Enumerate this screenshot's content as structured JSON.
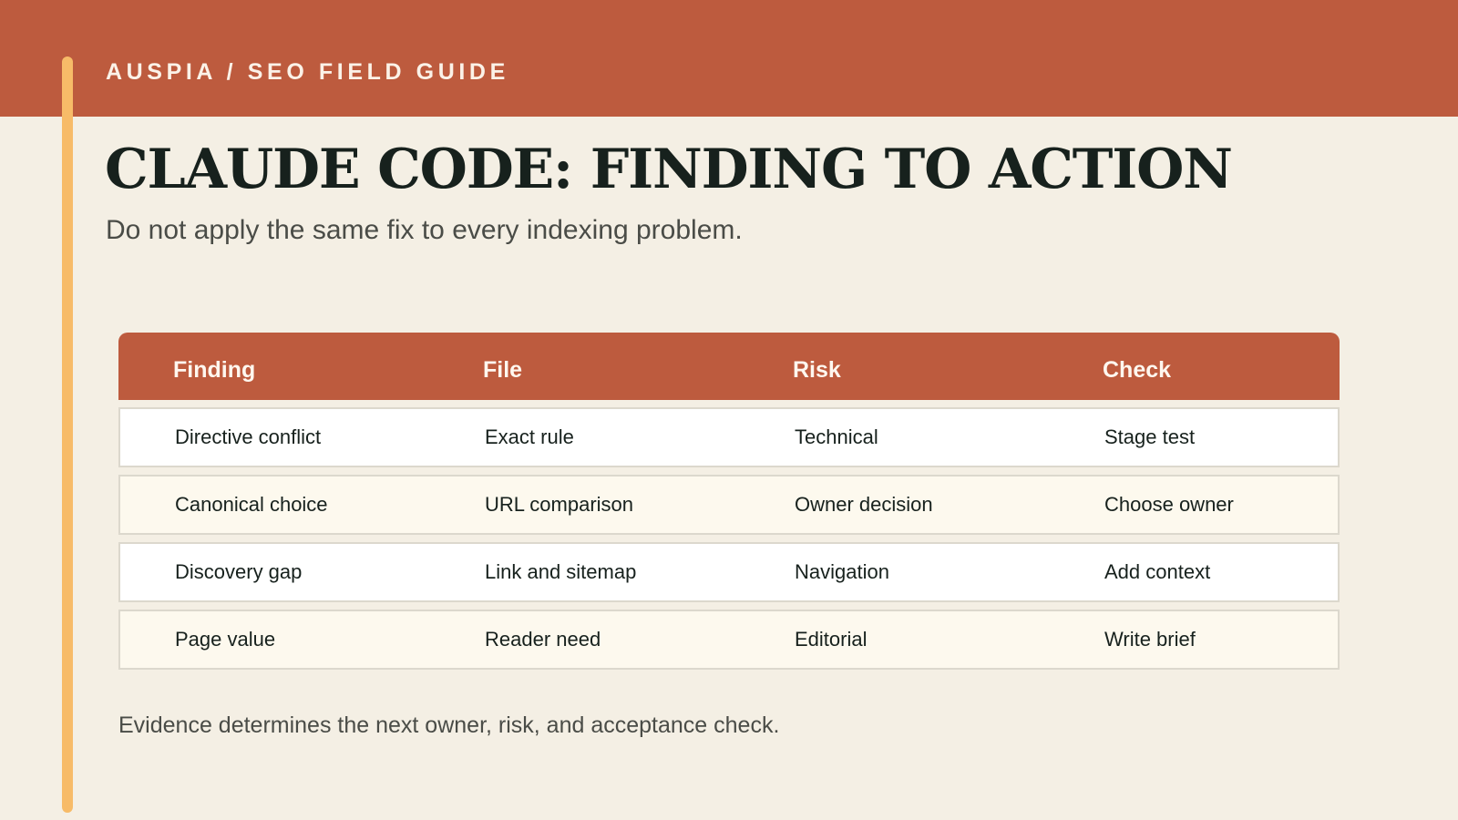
{
  "header": {
    "kicker": "AUSPIA / SEO FIELD GUIDE",
    "title": "CLAUDE CODE: FINDING TO ACTION",
    "subtitle": "Do not apply the same fix to every indexing problem."
  },
  "table": {
    "columns": [
      "Finding",
      "File",
      "Risk",
      "Check"
    ],
    "rows": [
      [
        "Directive conflict",
        "Exact rule",
        "Technical",
        "Stage test"
      ],
      [
        "Canonical choice",
        "URL comparison",
        "Owner decision",
        "Choose owner"
      ],
      [
        "Discovery gap",
        "Link and sitemap",
        "Navigation",
        "Add context"
      ],
      [
        "Page value",
        "Reader need",
        "Editorial",
        "Write brief"
      ]
    ]
  },
  "footer": {
    "note": "Evidence determines the next owner, risk, and acceptance check."
  },
  "colors": {
    "brand": "#bd5b3e",
    "accent": "#f7bb68",
    "background": "#f4efe4",
    "ink": "#17211d"
  }
}
